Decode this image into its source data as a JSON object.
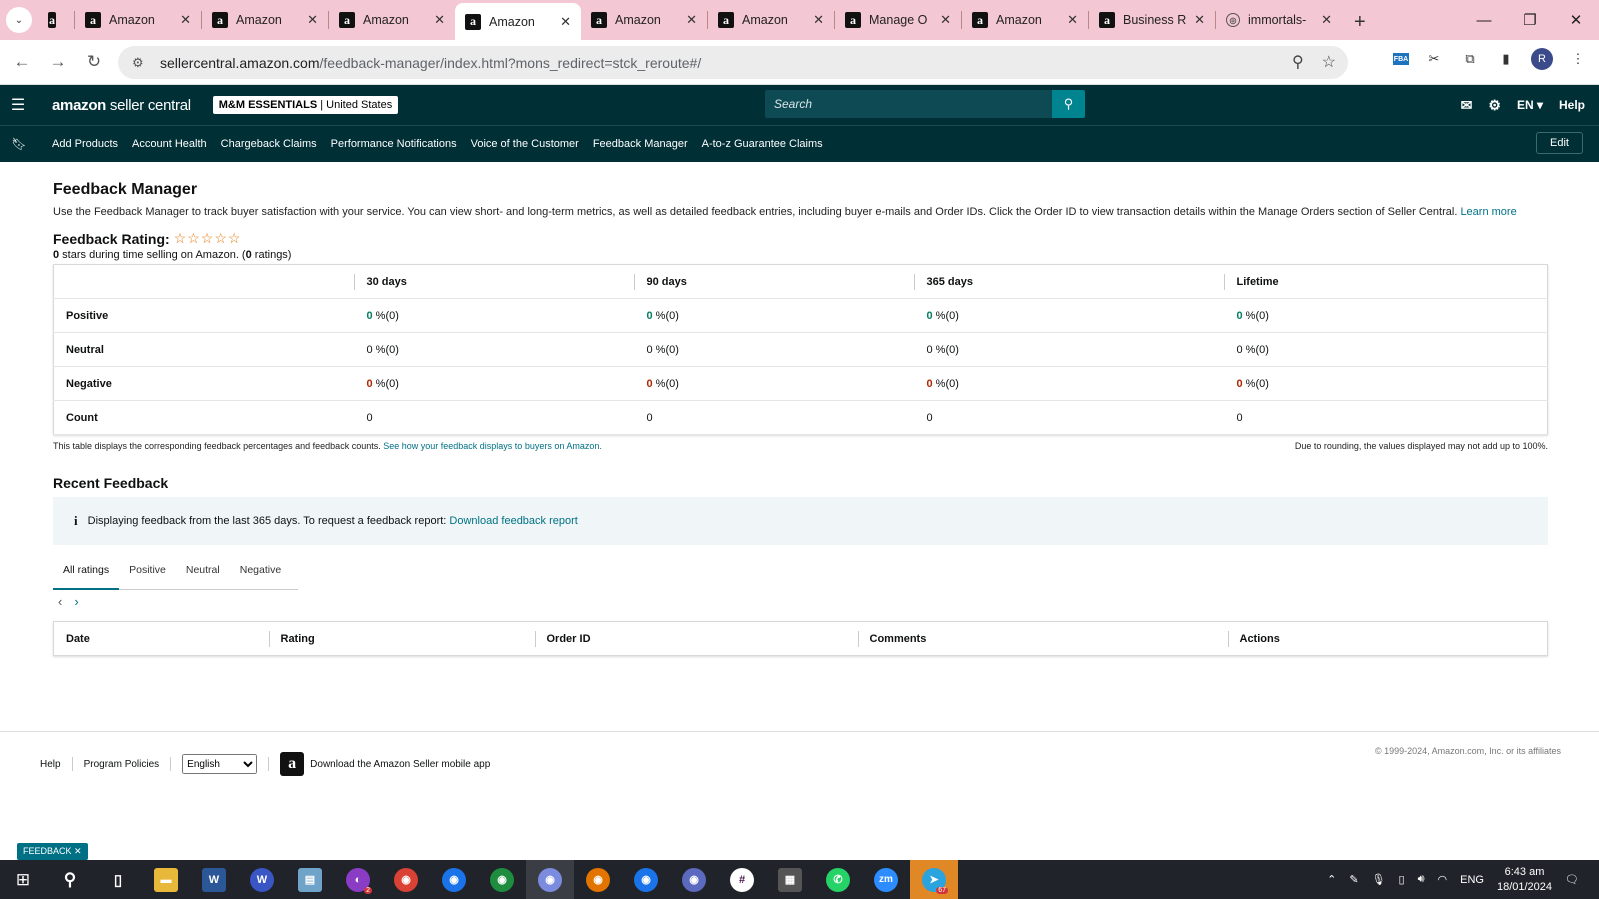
{
  "browser": {
    "tabs": [
      {
        "title": "",
        "active": false
      },
      {
        "title": "Amazon",
        "active": false
      },
      {
        "title": "Amazon",
        "active": false
      },
      {
        "title": "Amazon",
        "active": false
      },
      {
        "title": "Amazon",
        "active": true
      },
      {
        "title": "Amazon",
        "active": false
      },
      {
        "title": "Amazon",
        "active": false
      },
      {
        "title": "Manage O",
        "active": false
      },
      {
        "title": "Amazon",
        "active": false
      },
      {
        "title": "Business R",
        "active": false
      },
      {
        "title": "immortals-",
        "active": false
      }
    ],
    "url_host": "sellercentral.amazon.com",
    "url_path": "/feedback-manager/index.html?mons_redirect=stck_reroute#/",
    "profile_initial": "R"
  },
  "header": {
    "logo_bold": "amazon",
    "logo_light": " seller central",
    "store_name": "M&M ESSENTIALS",
    "store_region": "United States",
    "search_placeholder": "Search",
    "language": "EN",
    "help": "Help"
  },
  "nav": {
    "items": [
      "Add Products",
      "Account Health",
      "Chargeback Claims",
      "Performance Notifications",
      "Voice of the Customer",
      "Feedback Manager",
      "A-to-z Guarantee Claims"
    ],
    "edit": "Edit"
  },
  "page": {
    "title": "Feedback Manager",
    "description": "Use the Feedback Manager to track buyer satisfaction with your service. You can view short- and long-term metrics, as well as detailed feedback entries, including buyer e-mails and Order IDs. Click the Order ID to view transaction details within the Manage Orders section of Seller Central.",
    "learn_more": "Learn more",
    "rating_label": "Feedback Rating:",
    "stars": "☆☆☆☆☆",
    "star_value": "0",
    "rating_summary_mid": " stars during time selling on Amazon. (",
    "rating_count": "0",
    "rating_summary_end": " ratings)"
  },
  "metrics": {
    "columns": [
      "30 days",
      "90 days",
      "365 days",
      "Lifetime"
    ],
    "rows": [
      {
        "label": "Positive",
        "cells": [
          [
            "0",
            " %(0)"
          ],
          [
            "0",
            " %(0)"
          ],
          [
            "0",
            " %(0)"
          ],
          [
            "0",
            " %(0)"
          ]
        ]
      },
      {
        "label": "Neutral",
        "cells": [
          [
            "0",
            " %(0)"
          ],
          [
            "0",
            " %(0)"
          ],
          [
            "0",
            " %(0)"
          ],
          [
            "0",
            " %(0)"
          ]
        ]
      },
      {
        "label": "Negative",
        "cells": [
          [
            "0",
            " %(0)"
          ],
          [
            "0",
            " %(0)"
          ],
          [
            "0",
            " %(0)"
          ],
          [
            "0",
            " %(0)"
          ]
        ]
      },
      {
        "label": "Count",
        "cells": [
          [
            "0",
            ""
          ],
          [
            "0",
            ""
          ],
          [
            "0",
            ""
          ],
          [
            "0",
            ""
          ]
        ]
      }
    ],
    "note_left": "This table displays the corresponding feedback percentages and feedback counts.",
    "note_link": "See how your feedback displays to buyers on Amazon.",
    "note_right": "Due to rounding, the values displayed may not add up to 100%."
  },
  "recent": {
    "title": "Recent Feedback",
    "info_icon": "i",
    "info_text": "Displaying feedback from the last 365 days. To request a feedback report:",
    "info_link": "Download feedback report",
    "tabs": [
      "All ratings",
      "Positive",
      "Neutral",
      "Negative"
    ],
    "prev": "‹",
    "next": "›",
    "columns": [
      "Date",
      "Rating",
      "Order ID",
      "Comments",
      "Actions"
    ]
  },
  "footer": {
    "help": "Help",
    "policies": "Program Policies",
    "language_selected": "English",
    "app_text": "Download the Amazon Seller mobile app",
    "copyright": "© 1999-2024, Amazon.com, Inc. or its affiliates",
    "feedback_tab": "FEEDBACK ✕"
  },
  "taskbar": {
    "tray_lang": "ENG",
    "time": "6:43 am",
    "date": "18/01/2024",
    "telegram_badge": "67",
    "app_badge": "2"
  },
  "colors": {
    "seller_header": "#002f36",
    "link": "#007185",
    "positive": "#067d62",
    "negative": "#b12704",
    "tabstrip": "#f4c7d4"
  }
}
